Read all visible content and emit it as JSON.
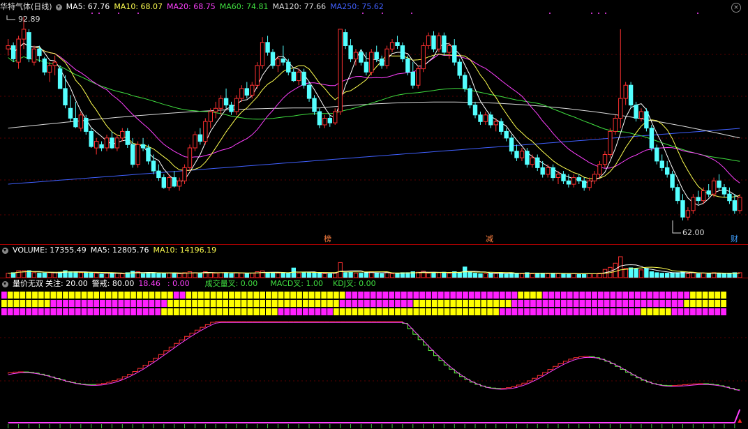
{
  "colors": {
    "up": "#ff3030",
    "down": "#54ffff",
    "ma5": "#ffffff",
    "ma10": "#ffff50",
    "ma20": "#ff40ff",
    "ma60": "#40e040",
    "ma120": "#dddddd",
    "ma250": "#4060ff",
    "bar_yellow": "#ffff00",
    "bar_magenta": "#ff20ff"
  },
  "main": {
    "stock": "华特气体",
    "period": "(日线)",
    "ma5": "MA5: 67.76",
    "ma10": "MA10: 68.07",
    "ma20": "MA20: 68.75",
    "ma60": "MA60: 74.81",
    "ma120": "MA120: 77.66",
    "ma250": "MA250: 75.62",
    "high_label": "92.89",
    "low_label": "62.00",
    "markers": [
      "榜",
      "减",
      "财"
    ]
  },
  "volume": {
    "vol": "VOLUME: 17355.49",
    "ma5": "MA5: 12805.76",
    "ma10": "MA10: 14196.19"
  },
  "indicator": {
    "name": "量价无双",
    "focus": "关注: 20.00",
    "warn": "警戒: 80.00",
    "v1": "18.46",
    "v2": ": 0.00",
    "vol_cross": "成交量叉: 0.00",
    "macd_cross": "MACD叉: 1.00",
    "kdj_cross": "KDJ叉: 0.00",
    "rows": [
      "VOL",
      "MACD",
      "KDJ"
    ]
  },
  "chart_data": {
    "type": "candlestick",
    "price_range": [
      62.0,
      92.89
    ],
    "candles": [
      [
        88,
        89.5,
        87,
        88.5
      ],
      [
        88.5,
        89,
        86,
        86.5
      ],
      [
        86,
        90,
        85,
        89.5
      ],
      [
        89.5,
        92.9,
        88,
        91
      ],
      [
        90.5,
        91,
        86,
        86.5
      ],
      [
        86,
        88.5,
        85.5,
        88
      ],
      [
        88,
        88.5,
        86,
        87
      ],
      [
        86.5,
        86.8,
        84,
        84.5
      ],
      [
        84.5,
        86,
        83,
        85.5
      ],
      [
        85.5,
        87,
        84,
        86
      ],
      [
        85,
        85.5,
        82,
        82
      ],
      [
        82,
        84,
        79,
        79.5
      ],
      [
        79,
        81,
        77,
        77.5
      ],
      [
        77.5,
        80,
        76,
        76.2
      ],
      [
        76,
        78.5,
        75.5,
        78
      ],
      [
        77.5,
        78,
        75,
        75.5
      ],
      [
        75.5,
        76,
        73,
        73.2
      ],
      [
        73,
        74.5,
        72,
        74
      ],
      [
        73.5,
        74,
        72.5,
        73
      ],
      [
        73,
        75,
        72.5,
        74.5
      ],
      [
        74.5,
        75.5,
        72.8,
        73
      ],
      [
        73,
        75,
        72.5,
        74.5
      ],
      [
        74.5,
        76,
        74,
        75.5
      ],
      [
        75.5,
        76,
        73,
        73.5
      ],
      [
        73.5,
        74.5,
        70,
        70.5
      ],
      [
        70.5,
        74,
        70,
        73.5
      ],
      [
        73.5,
        74.5,
        72.5,
        73
      ],
      [
        73,
        73.5,
        70.5,
        71
      ],
      [
        71,
        72,
        69,
        69.5
      ],
      [
        69.5,
        70.5,
        68,
        68.5
      ],
      [
        68.5,
        69,
        66.8,
        67
      ],
      [
        67,
        69,
        66.5,
        68.5
      ],
      [
        68.5,
        69.5,
        67,
        67.2
      ],
      [
        67.2,
        68.5,
        66.5,
        68
      ],
      [
        68,
        70.5,
        67.5,
        70
      ],
      [
        70,
        73.5,
        69.5,
        73
      ],
      [
        73,
        75.5,
        72.5,
        75
      ],
      [
        75,
        76,
        73.5,
        74
      ],
      [
        74,
        77.5,
        73.5,
        77
      ],
      [
        77,
        79,
        76,
        78.5
      ],
      [
        78.5,
        80,
        77.5,
        79
      ],
      [
        79,
        81,
        78,
        80.5
      ],
      [
        80.5,
        82,
        79,
        79.5
      ],
      [
        79.5,
        80,
        78,
        78.5
      ],
      [
        78.5,
        81,
        78,
        80.5
      ],
      [
        80.5,
        82.5,
        80,
        82
      ],
      [
        82,
        83,
        80.5,
        81
      ],
      [
        81,
        83,
        80.5,
        82.5
      ],
      [
        82.5,
        86,
        82,
        85.5
      ],
      [
        85.5,
        89.8,
        85,
        89
      ],
      [
        89,
        90,
        87,
        87.5
      ],
      [
        87.5,
        88,
        85,
        85.5
      ],
      [
        85.5,
        87,
        84.5,
        86.5
      ],
      [
        86.5,
        88.5,
        85.5,
        86
      ],
      [
        86,
        86.5,
        84,
        84.5
      ],
      [
        84.5,
        85,
        83,
        83.2
      ],
      [
        83.2,
        85,
        82.5,
        84.5
      ],
      [
        84.5,
        85,
        82,
        82.5
      ],
      [
        82.5,
        83,
        80,
        80.5
      ],
      [
        80.5,
        81,
        78,
        78.5
      ],
      [
        78.5,
        79,
        76,
        76.5
      ],
      [
        76.5,
        78,
        76,
        77.5
      ],
      [
        77.5,
        78,
        76.2,
        76.8
      ],
      [
        76.8,
        79,
        76.5,
        78.5
      ],
      [
        78.5,
        91,
        78,
        91
      ],
      [
        90.5,
        91,
        88,
        88.5
      ],
      [
        88.5,
        89.5,
        86,
        86.5
      ],
      [
        86.5,
        88,
        85.5,
        87.5
      ],
      [
        87.5,
        88,
        85.5,
        86
      ],
      [
        86,
        87.5,
        84,
        84.5
      ],
      [
        84.5,
        88,
        84,
        87.5
      ],
      [
        87.5,
        88.5,
        86,
        86.5
      ],
      [
        86.5,
        87,
        85,
        85.5
      ],
      [
        85.5,
        88.5,
        85,
        88
      ],
      [
        88,
        89.5,
        87.5,
        89
      ],
      [
        89,
        90,
        88,
        88.5
      ],
      [
        88.5,
        89,
        86,
        86.5
      ],
      [
        86.5,
        87,
        84,
        84.5
      ],
      [
        84.5,
        86,
        82,
        82.5
      ],
      [
        82.5,
        85.5,
        82,
        85
      ],
      [
        85,
        89,
        84.5,
        88.5
      ],
      [
        88.5,
        90.5,
        88,
        90
      ],
      [
        90,
        90.7,
        87.5,
        88
      ],
      [
        88,
        90.5,
        87.5,
        90
      ],
      [
        90,
        90.5,
        87,
        87.5
      ],
      [
        87.5,
        89,
        86.5,
        88.5
      ],
      [
        88.5,
        89.5,
        85.5,
        86
      ],
      [
        86,
        86.5,
        83.5,
        84
      ],
      [
        84,
        84.5,
        81.5,
        82
      ],
      [
        82,
        82.5,
        79,
        79.5
      ],
      [
        79.5,
        80,
        77.5,
        78
      ],
      [
        78,
        78.5,
        76.5,
        77
      ],
      [
        77,
        78.5,
        76.5,
        78
      ],
      [
        78,
        78.5,
        76,
        76.5
      ],
      [
        76.5,
        77.5,
        75.5,
        77
      ],
      [
        77,
        77.5,
        75,
        75.5
      ],
      [
        75.5,
        76,
        74,
        74.5
      ],
      [
        74.5,
        75,
        72,
        72.5
      ],
      [
        72.5,
        73.5,
        71,
        71.5
      ],
      [
        71.5,
        73,
        71,
        72.5
      ],
      [
        72.5,
        73,
        70,
        70.5
      ],
      [
        70.5,
        72,
        70,
        71.5
      ],
      [
        71.5,
        72,
        69.5,
        70
      ],
      [
        70,
        71,
        68.5,
        69
      ],
      [
        69,
        70.5,
        68.5,
        70
      ],
      [
        70,
        70.5,
        68,
        68.5
      ],
      [
        68.5,
        69.5,
        67.5,
        69
      ],
      [
        69,
        69.5,
        67.5,
        68
      ],
      [
        68,
        69,
        67,
        67.5
      ],
      [
        67.5,
        69,
        67,
        68.5
      ],
      [
        68.5,
        69,
        67.5,
        68
      ],
      [
        68,
        68.5,
        66.5,
        67
      ],
      [
        67,
        68.5,
        66.5,
        68
      ],
      [
        68,
        69.5,
        67.5,
        69
      ],
      [
        69,
        71,
        68.5,
        70.5
      ],
      [
        70.5,
        72.5,
        70,
        72
      ],
      [
        72,
        76,
        71.5,
        75.5
      ],
      [
        75.5,
        78,
        75,
        77.5
      ],
      [
        77.5,
        91,
        76,
        80.5
      ],
      [
        80.5,
        83,
        79.5,
        82.5
      ],
      [
        82.5,
        83,
        79,
        79.5
      ],
      [
        79.5,
        80,
        77,
        77.5
      ],
      [
        77.5,
        79,
        77,
        78.5
      ],
      [
        78.5,
        79,
        75.5,
        76
      ],
      [
        76,
        76.5,
        72.5,
        73
      ],
      [
        73,
        73.5,
        70.5,
        71
      ],
      [
        71,
        72,
        69.5,
        70
      ],
      [
        70,
        71,
        68.5,
        69
      ],
      [
        69,
        69.5,
        66.5,
        67
      ],
      [
        67,
        67.5,
        64.5,
        65
      ],
      [
        65,
        66,
        62,
        62.5
      ],
      [
        62.5,
        64,
        62,
        63.5
      ],
      [
        63.5,
        66,
        63,
        65.5
      ],
      [
        65.5,
        66.5,
        64.5,
        65
      ],
      [
        65,
        67,
        64.5,
        66.5
      ],
      [
        66.5,
        67.5,
        65.5,
        66
      ],
      [
        66,
        68.5,
        65.5,
        68
      ],
      [
        68,
        69,
        66.5,
        67
      ],
      [
        67,
        67.5,
        65.5,
        66
      ],
      [
        66,
        67,
        64.5,
        65
      ],
      [
        65,
        66,
        63,
        63.5
      ],
      [
        63.5,
        66,
        63,
        65.5
      ]
    ],
    "volume_range": [
      0,
      17355.49
    ],
    "indicator_range": [
      0,
      100
    ]
  }
}
